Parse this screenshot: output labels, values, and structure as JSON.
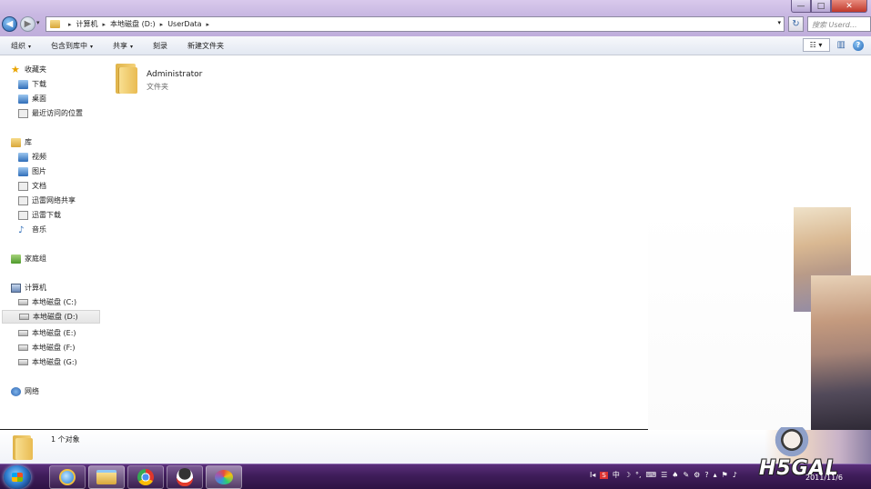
{
  "titlebar": {
    "controls": {
      "minimize": "—",
      "maximize": "□",
      "close": "✕"
    }
  },
  "nav": {
    "back": "◀",
    "forward": "▶",
    "recent_caret": "▾",
    "refresh": "↻"
  },
  "address": {
    "breadcrumbs": [
      "计算机",
      "本地磁盘 (D:)",
      "UserData"
    ],
    "sep": "▸",
    "drop": "▾"
  },
  "search": {
    "placeholder": "搜索 Userd..."
  },
  "toolbar": {
    "items": [
      {
        "label": "组织",
        "caret": "▾"
      },
      {
        "label": "包含到库中",
        "caret": "▾"
      },
      {
        "label": "共享",
        "caret": "▾"
      },
      {
        "label": "刻录",
        "caret": ""
      },
      {
        "label": "新建文件夹",
        "caret": ""
      }
    ],
    "view_label": "☷ ▾",
    "pane_label": "▥",
    "help_label": "?"
  },
  "sidebar": {
    "favorites": {
      "label": "收藏夹",
      "items": [
        "下载",
        "桌面",
        "最近访问的位置"
      ]
    },
    "libraries": {
      "label": "库",
      "items": [
        "视频",
        "图片",
        "文档",
        "迅雷网络共享",
        "迅雷下载",
        "音乐"
      ]
    },
    "homegroup": {
      "label": "家庭组"
    },
    "computer": {
      "label": "计算机",
      "items": [
        "本地磁盘 (C:)",
        "本地磁盘 (D:)",
        "本地磁盘 (E:)",
        "本地磁盘 (F:)",
        "本地磁盘 (G:)"
      ]
    },
    "network": {
      "label": "网络"
    }
  },
  "content": {
    "files": [
      {
        "name": "Administrator",
        "type": "文件夹"
      }
    ]
  },
  "details": {
    "count_text": "1 个对象"
  },
  "taskbar": {
    "tray": {
      "items": [
        "I◂",
        "S",
        "中",
        "☽",
        "°,",
        "⌨",
        "☰",
        "♠",
        "✎",
        "⚙",
        "?",
        "▴",
        "⚑",
        "♪"
      ]
    },
    "clock_time": "",
    "clock_date": "2011/11/6"
  },
  "watermark": {
    "logo": "H5GAL"
  }
}
